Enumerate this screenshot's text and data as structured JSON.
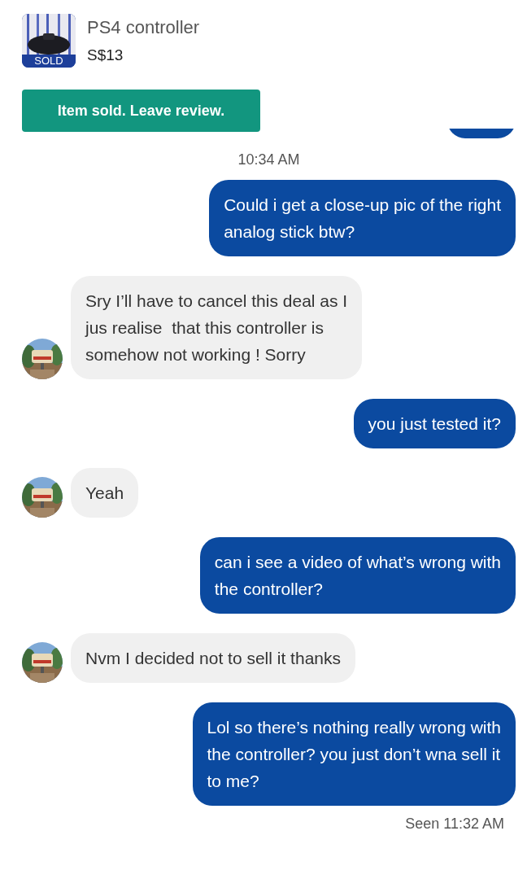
{
  "listing": {
    "title": "PS4 controller",
    "price": "S$13",
    "badge": "SOLD"
  },
  "action_button": {
    "label": "Item sold. Leave review."
  },
  "messages": [
    {
      "kind": "sent_cut"
    },
    {
      "kind": "time",
      "text": "10:34 AM"
    },
    {
      "kind": "sent",
      "text": "Could i get a close-up pic of the right\nanalog stick btw?"
    },
    {
      "kind": "received",
      "text": "Sry I’ll have to cancel this deal as I\njus realise  that this controller is\nsomehow not working ! Sorry"
    },
    {
      "kind": "sent",
      "text": "you just tested it?"
    },
    {
      "kind": "received",
      "text": "Yeah"
    },
    {
      "kind": "sent",
      "text": "can i see a video of what’s wrong with\nthe controller?"
    },
    {
      "kind": "received",
      "text": "Nvm I decided not to sell it thanks"
    },
    {
      "kind": "sent",
      "text": "Lol so there’s nothing really wrong with\nthe controller? you just don’t wna sell it\nto me?"
    }
  ],
  "receipt": "Seen 11:32 AM"
}
